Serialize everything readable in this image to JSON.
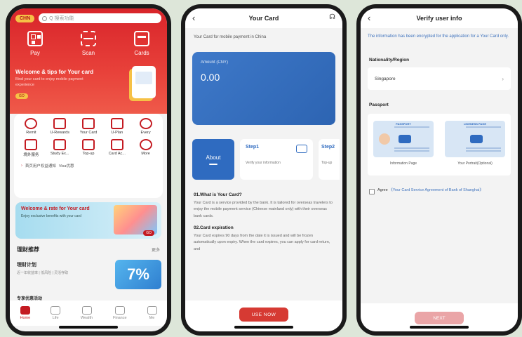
{
  "phone1": {
    "status": {
      "location": "CHN",
      "search_placeholder": "Q 搜索功能"
    },
    "quick_actions": [
      {
        "label": "Pay",
        "icon": "qr-code-icon"
      },
      {
        "label": "Scan",
        "icon": "scan-icon"
      },
      {
        "label": "Cards",
        "icon": "card-icon"
      }
    ],
    "banner": {
      "title": "Welcome & tips for Your card",
      "subtitle": "Bind your card to enjoy mobile payment experience",
      "go": "GO"
    },
    "services": [
      {
        "label": "Remit",
        "icon": "globe-icon"
      },
      {
        "label": "U-Rewards",
        "icon": "rewards-icon"
      },
      {
        "label": "Your Card",
        "icon": "card-icon"
      },
      {
        "label": "U-Plan",
        "icon": "plan-icon"
      },
      {
        "label": "Every",
        "icon": "bag-icon"
      },
      {
        "label": "境外服务",
        "icon": "service-icon"
      },
      {
        "label": "Study Ex...",
        "icon": "study-icon"
      },
      {
        "label": "Top-up",
        "icon": "phone-icon"
      },
      {
        "label": "Card Ac...",
        "icon": "card-account-icon"
      },
      {
        "label": "More",
        "icon": "more-icon"
      }
    ],
    "notice": {
      "text": "首页用户权益通知",
      "extra": "Visa优惠"
    },
    "promo": {
      "title": "Welcome & rate for Your card",
      "desc": "Enjoy exclusive benefits with your card",
      "go": "GO"
    },
    "section": {
      "title": "理财推荐",
      "more": "更多"
    },
    "finance": {
      "title": "理财计划",
      "desc": "近一年收益率 | 低风险 | 灵活存取",
      "percent": "7%"
    },
    "bottom_hint": "专享优惠活动",
    "tabs": [
      {
        "label": "Home",
        "active": true
      },
      {
        "label": "Life",
        "active": false
      },
      {
        "label": "Wealth",
        "active": false
      },
      {
        "label": "Finance",
        "active": false
      },
      {
        "label": "Me",
        "active": false
      }
    ]
  },
  "phone2": {
    "title": "Your Card",
    "back_icon": "back-chevron-icon",
    "subtitle": "Your Card for mobile payment in China",
    "card": {
      "label": "Amount (CNY)",
      "amount": "0.00"
    },
    "about_label": "About",
    "step1": {
      "title": "Step1",
      "desc": "Verify your information"
    },
    "step2": {
      "title": "Step2",
      "desc": "Top-up"
    },
    "faq": [
      {
        "q": "01.What is Your Card?",
        "a": "Your Card is a service provided by the bank. It is tailored for overseas travelers to enjoy the mobile payment service (Chinese mainland only) with their overseas bank cards."
      },
      {
        "q": "02.Card expiration",
        "a": "Your Card expires 90 days from the date it is issued and will be frozen automatically upon expiry. When the card expires, you can apply for card return, and"
      }
    ],
    "cta": "USE NOW"
  },
  "phone3": {
    "title": "Verify user info",
    "info": "The information has been encrypted for the application for a Your Card only.",
    "nationality_label": "Nationality/Region",
    "nationality_value": "Singapore",
    "passport_label": "Passport",
    "passports": [
      {
        "tag": "PASSPORT",
        "caption": "Information Page"
      },
      {
        "tag": "LIKENESS PAGE",
        "caption": "Your Portrait(Optional)"
      }
    ],
    "agree_prefix": "Agree",
    "agree_link": "《Your Card Service Agreement of Bank of Shanghai》",
    "next": "NEXT"
  },
  "colors": {
    "brand_red": "#d8242a",
    "brand_blue": "#2f6bc0",
    "background": "#dde6d9"
  }
}
